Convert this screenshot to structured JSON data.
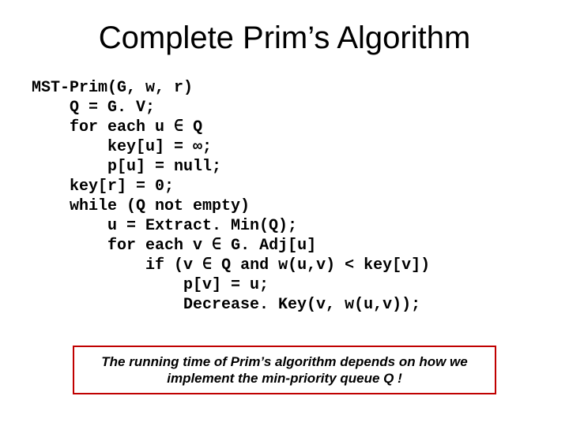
{
  "title": "Complete Prim’s Algorithm",
  "code": {
    "l1": "MST-Prim(G, w, r)",
    "l2": "    Q = G. V;",
    "l3": "    for each u ∈ Q",
    "l4": "        key[u] = ∞;",
    "l5": "        p[u] = null;",
    "l6": "    key[r] = 0;",
    "l7": "    while (Q not empty)",
    "l8": "        u = Extract. Min(Q);",
    "l9": "        for each v ∈ G. Adj[u]",
    "l10": "            if (v ∈ Q and w(u,v) < key[v])",
    "l11": "                p[v] = u;",
    "l12": "                Decrease. Key(v, w(u,v));"
  },
  "note": "The running time of Prim’s algorithm depends on how we implement the  min-priority queue Q !"
}
